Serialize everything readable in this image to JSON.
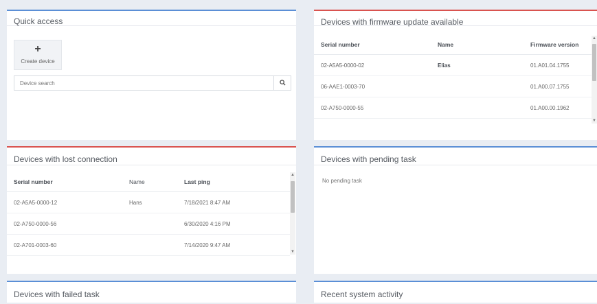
{
  "quick_access": {
    "title": "Quick access",
    "create_device_label": "Create device",
    "search_placeholder": "Device search"
  },
  "firmware_panel": {
    "title": "Devices with firmware update available",
    "columns": [
      "Serial number",
      "Name",
      "Firmware version"
    ],
    "rows": [
      [
        "02-A5A5-0000-02",
        "Elias",
        "01.A01.04.1755"
      ],
      [
        "06-AAE1-0003-70",
        "",
        "01.A00.07.1755"
      ],
      [
        "02-A750-0000-55",
        "",
        "01.A00.00.1962"
      ]
    ]
  },
  "lost_connection_panel": {
    "title": "Devices with lost connection",
    "columns": [
      "Serial number",
      "Name",
      "Last ping"
    ],
    "rows": [
      [
        "02-A5A5-0000-12",
        "Hans",
        "7/18/2021 8:47 AM"
      ],
      [
        "02-A750-0000-56",
        "",
        "6/30/2020 4:16 PM"
      ],
      [
        "02-A701-0003-60",
        "",
        "7/14/2020 9:47 AM"
      ]
    ]
  },
  "pending_task_panel": {
    "title": "Devices with pending task",
    "empty_text": "No pending task"
  },
  "failed_task_panel": {
    "title": "Devices with failed task"
  },
  "recent_activity_panel": {
    "title": "Recent system activity"
  },
  "colors": {
    "background": "#e9edf3",
    "panel_accent_blue": "#5b8fd6",
    "panel_accent_red": "#d9534f"
  },
  "icons": {
    "create": "plus-icon",
    "search": "search-icon",
    "scroll_up": "chevron-up-icon",
    "scroll_down": "chevron-down-icon"
  }
}
